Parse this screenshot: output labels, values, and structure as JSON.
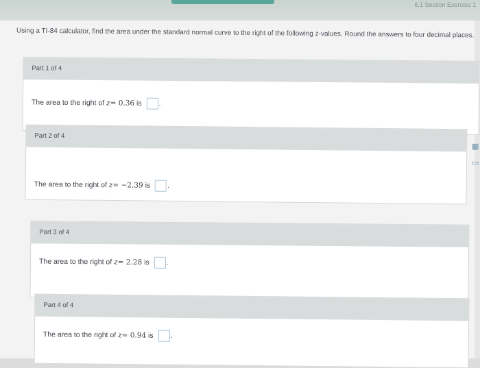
{
  "header": {
    "breadcrumb": "6.1 Section Exercise 1"
  },
  "instructions": "Using a TI-84 calculator, find the area under the standard normal curve to the right of the following z-values. Round the answers to four decimal places.",
  "parts": [
    {
      "label": "Part 1 of 4",
      "prefix": "The area to the right of",
      "variable": "z",
      "value": "= 0.36",
      "suffix": "is",
      "answer": ""
    },
    {
      "label": "Part 2 of 4",
      "prefix": "The area to the right of",
      "variable": "z",
      "value": "= −2.39",
      "suffix": "is",
      "answer": ""
    },
    {
      "label": "Part 3 of 4",
      "prefix": "The area to the right of",
      "variable": "z",
      "value": "= 2.28",
      "suffix": "is",
      "answer": ""
    },
    {
      "label": "Part 4 of 4",
      "prefix": "The area to the right of",
      "variable": "z",
      "value": "= 0.94",
      "suffix": "is",
      "answer": ""
    }
  ],
  "side_tools": [
    "calculator-icon",
    "data-icon",
    "video-icon"
  ]
}
